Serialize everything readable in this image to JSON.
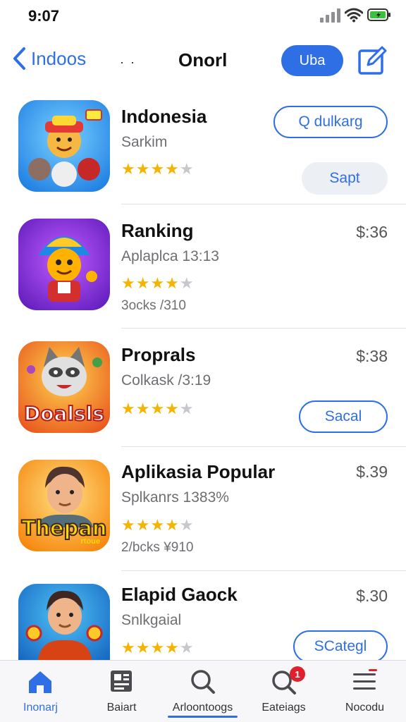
{
  "status_bar": {
    "time": "9:07"
  },
  "nav": {
    "back_label": "Indoos",
    "dots": "·  ·",
    "title": "Onorl",
    "pill_label": "Uba",
    "icons": {
      "back": "chevron-left-icon",
      "edit": "compose-icon"
    }
  },
  "apps": [
    {
      "name": "Indonesia",
      "subtitle": "Sarkim",
      "rating": 4,
      "extra": "",
      "price": "",
      "button_primary": "Q dulkarg",
      "button_secondary": "Sapt"
    },
    {
      "name": "Ranking",
      "subtitle": "Aplaplca 13:13",
      "rating": 4,
      "extra": "3ocks /310",
      "price": "$:36",
      "button_primary": "",
      "button_secondary": ""
    },
    {
      "name": "Proprals",
      "subtitle": "Colkask /3:19",
      "rating": 4,
      "extra": "",
      "price": "$:38",
      "button_primary": "Sacal",
      "button_secondary": "",
      "icon_text": "Doalsls"
    },
    {
      "name": "Aplikasia Popular",
      "subtitle": "Splkanrs 1383%",
      "rating": 4,
      "extra": "2/bcks ¥910",
      "price": "$.39",
      "button_primary": "",
      "button_secondary": "",
      "icon_text": "Thepan",
      "icon_subtext": "rtoue"
    },
    {
      "name": "Elapid Gaock",
      "subtitle": "Snlkgaial",
      "rating": 4,
      "extra": "",
      "price": "$.30",
      "button_primary": "SCategl",
      "button_secondary": ""
    }
  ],
  "tabs": [
    {
      "label": "Inonarj",
      "icon": "home-icon",
      "active": true
    },
    {
      "label": "Baiart",
      "icon": "news-icon",
      "active": false
    },
    {
      "label": "Arloontoogs",
      "icon": "search-icon",
      "active": false
    },
    {
      "label": "Eateiags",
      "icon": "search-badge-icon",
      "active": false,
      "badge": "1"
    },
    {
      "label": "Nocodu",
      "icon": "menu-icon",
      "active": false
    }
  ],
  "colors": {
    "accent": "#2f6fe6",
    "star": "#f5b400",
    "badge": "#e0202c"
  }
}
